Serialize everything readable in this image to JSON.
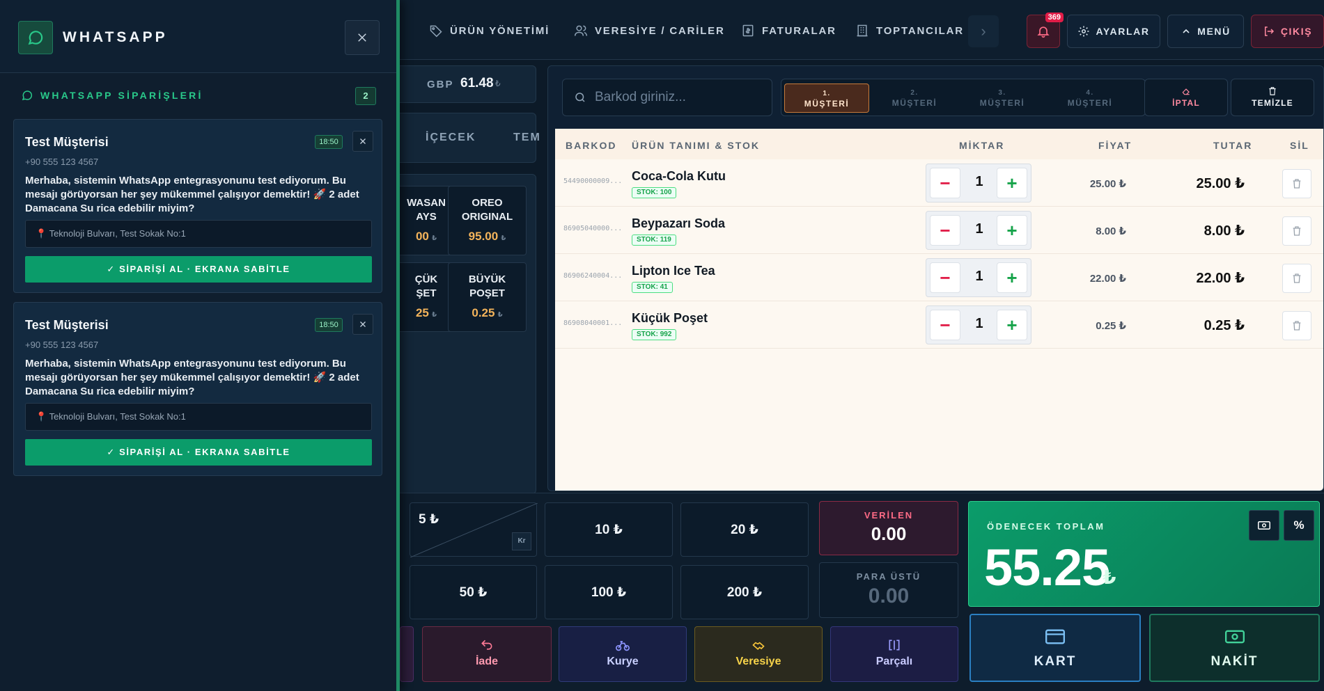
{
  "nav": {
    "urun_yonetimi": "ÜRÜN YÖNETİMİ",
    "veresiye": "VERESİYE / CARİLER",
    "faturalar": "FATURALAR",
    "toptancilar": "TOPTANCILAR",
    "notifications_badge": "369",
    "ayarlar": "AYARLAR",
    "menu": "MENÜ",
    "cikis": "ÇIKIŞ"
  },
  "rate": {
    "currency": "GBP",
    "value": "61.48",
    "unit": "₺"
  },
  "categories": [
    "İÇECEK",
    "TEM"
  ],
  "products": [
    {
      "name_line1": "WASAN",
      "name_line2": "AYS",
      "price": "00",
      "unit": "₺"
    },
    {
      "name_line1": "OREO",
      "name_line2": "ORIGINAL",
      "price": "95.00",
      "unit": "₺"
    },
    {
      "name_line1": "ÇÜK",
      "name_line2": "ŞET",
      "price": "25",
      "unit": "₺"
    },
    {
      "name_line1": "BÜYÜK",
      "name_line2": "POŞET",
      "price": "0.25",
      "unit": "₺"
    }
  ],
  "barcode": {
    "placeholder": "Barkod giriniz..."
  },
  "customers": [
    {
      "num": "1.",
      "label": "MÜŞTERİ"
    },
    {
      "num": "2.",
      "label": "MÜŞTERİ"
    },
    {
      "num": "3.",
      "label": "MÜŞTERİ"
    },
    {
      "num": "4.",
      "label": "MÜŞTERİ"
    }
  ],
  "actions": {
    "iptal": "İPTAL",
    "temizle": "TEMİZLE"
  },
  "cart": {
    "headers": {
      "barkod": "BARKOD",
      "urun": "ÜRÜN TANIMI & STOK",
      "miktar": "MİKTAR",
      "fiyat": "FİYAT",
      "tutar": "TUTAR",
      "sil": "SİL"
    },
    "rows": [
      {
        "barcode": "54490000009...",
        "name": "Coca-Cola Kutu",
        "stock": "STOK: 100",
        "qty": "1",
        "price": "25.00 ₺",
        "total": "25.00 ₺"
      },
      {
        "barcode": "86905040000...",
        "name": "Beypazarı Soda",
        "stock": "STOK: 119",
        "qty": "1",
        "price": "8.00 ₺",
        "total": "8.00 ₺"
      },
      {
        "barcode": "86906240004...",
        "name": "Lipton Ice Tea",
        "stock": "STOK: 41",
        "qty": "1",
        "price": "22.00 ₺",
        "total": "22.00 ₺"
      },
      {
        "barcode": "86908040001...",
        "name": "Küçük Poşet",
        "stock": "STOK: 992",
        "qty": "1",
        "price": "0.25 ₺",
        "total": "0.25 ₺"
      }
    ]
  },
  "money": {
    "m5": "5 ₺",
    "kr": "Kr",
    "m10": "10 ₺",
    "m20": "20 ₺",
    "m50": "50 ₺",
    "m100": "100 ₺",
    "m200": "200 ₺"
  },
  "verilen": {
    "label": "VERİLEN",
    "value": "0.00"
  },
  "para_ustu": {
    "label": "PARA ÜSTÜ",
    "value": "0.00"
  },
  "total": {
    "label": "ÖDENECEK TOPLAM",
    "value": "55.25",
    "unit": "₺",
    "percent": "%"
  },
  "pay": {
    "kart": "KART",
    "nakit": "NAKİT"
  },
  "bottom_actions": {
    "iade": "İade",
    "kurye": "Kurye",
    "veresiye": "Veresiye",
    "parcali": "Parçalı"
  },
  "whatsapp": {
    "title": "WHATSAPP",
    "section": "WHATSAPP SİPARİŞLERİ",
    "count": "2",
    "orders": [
      {
        "name": "Test Müşterisi",
        "time": "18:50",
        "phone": "+90 555 123 4567",
        "message": "Merhaba, sistemin WhatsApp entegrasyonunu test ediyorum. Bu mesajı görüyorsan her şey mükemmel çalışıyor demektir! 🚀 2 adet Damacana Su rica edebilir miyim?",
        "address": "Teknoloji Bulvarı, Test Sokak No:1",
        "button": "SİPARİŞİ AL · EKRANA SABİTLE"
      },
      {
        "name": "Test Müşterisi",
        "time": "18:50",
        "phone": "+90 555 123 4567",
        "message": "Merhaba, sistemin WhatsApp entegrasyonunu test ediyorum. Bu mesajı görüyorsan her şey mükemmel çalışıyor demektir! 🚀 2 adet Damacana Su rica edebilir miyim?",
        "address": "Teknoloji Bulvarı, Test Sokak No:1",
        "button": "SİPARİŞİ AL · EKRANA SABİTLE"
      }
    ]
  }
}
